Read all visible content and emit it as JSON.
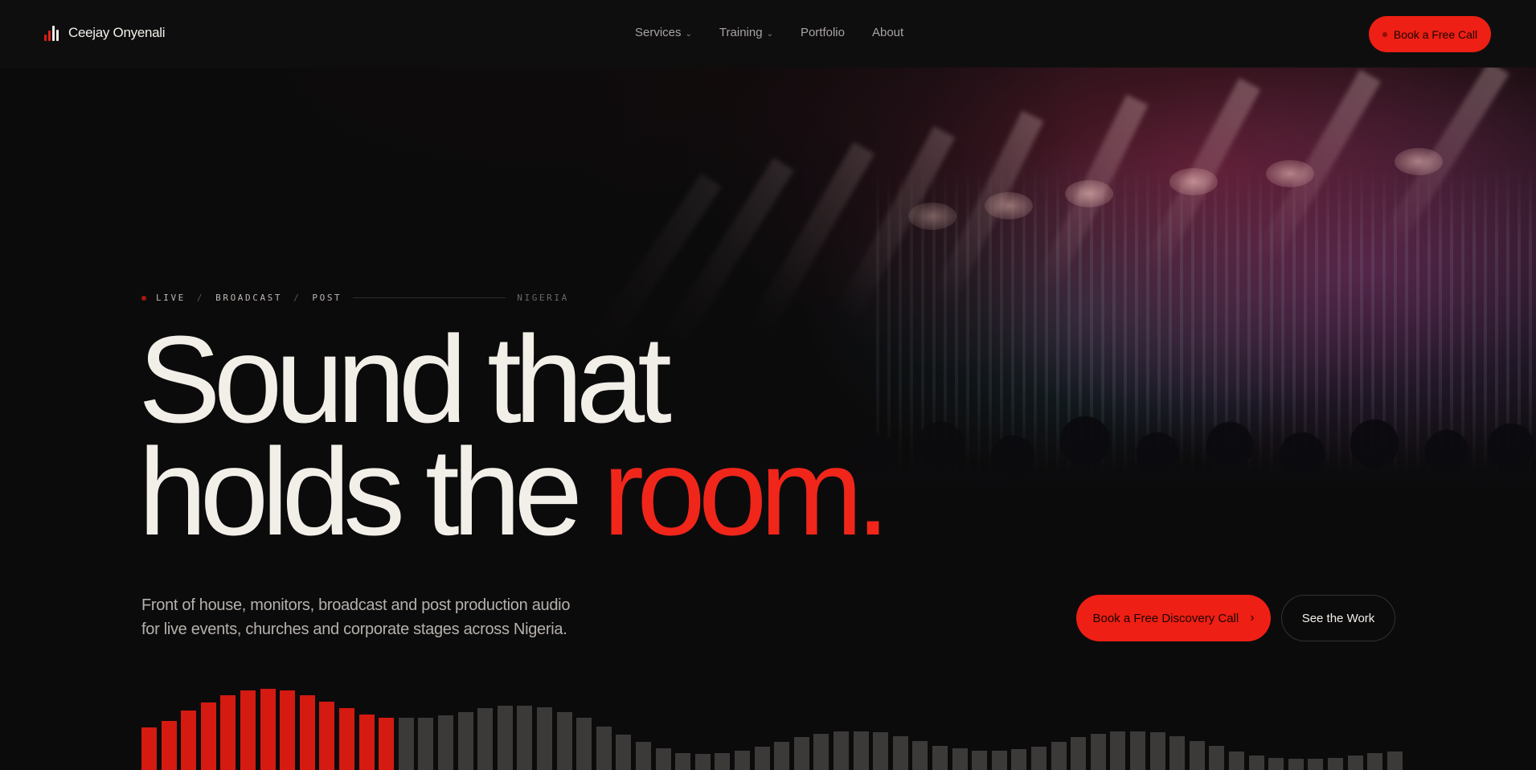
{
  "brand": {
    "name": "Ceejay Onyenali"
  },
  "nav": {
    "items": [
      {
        "label": "Services",
        "has_dropdown": true
      },
      {
        "label": "Training",
        "has_dropdown": true
      },
      {
        "label": "Portfolio",
        "has_dropdown": false
      },
      {
        "label": "About",
        "has_dropdown": false
      }
    ],
    "cta_label": "Book a Free Call"
  },
  "hero": {
    "eyebrow": {
      "tags": [
        "LIVE",
        "BROADCAST",
        "POST"
      ],
      "separator": "/",
      "location": "NIGERIA"
    },
    "headline_line1": "Sound that",
    "headline_line2_plain": "holds the ",
    "headline_line2_accent": "room.",
    "subcopy_line1": "Front of house, monitors, broadcast and post production audio",
    "subcopy_line2": "for live events, churches and corporate stages across Nigeria.",
    "primary_cta": "Book a Free Discovery Call",
    "secondary_cta": "See the Work"
  },
  "colors": {
    "accent": "#ee1f14",
    "background": "#0c0b0c",
    "text": "#f2efe8",
    "bar_active": "#d41a11",
    "bar_inactive": "#3c3a39"
  },
  "icons": {
    "logo": "sound-bars-icon",
    "dropdown": "chevron-down-icon",
    "arrow": "chevron-right-icon"
  },
  "visualizer": {
    "active_count": 13,
    "levels": [
      0.35,
      0.41,
      0.49,
      0.56,
      0.62,
      0.66,
      0.67,
      0.66,
      0.62,
      0.57,
      0.51,
      0.46,
      0.43,
      0.43,
      0.43,
      0.45,
      0.48,
      0.51,
      0.53,
      0.53,
      0.52,
      0.48,
      0.43,
      0.36,
      0.29,
      0.23,
      0.18,
      0.14,
      0.13,
      0.14,
      0.16,
      0.19,
      0.23,
      0.27,
      0.3,
      0.32,
      0.32,
      0.31,
      0.28,
      0.24,
      0.2,
      0.18,
      0.16,
      0.16,
      0.17,
      0.19,
      0.23,
      0.27,
      0.3,
      0.32,
      0.32,
      0.31,
      0.28,
      0.24,
      0.2,
      0.15,
      0.12,
      0.1,
      0.09,
      0.09,
      0.1,
      0.12,
      0.14,
      0.15
    ]
  }
}
